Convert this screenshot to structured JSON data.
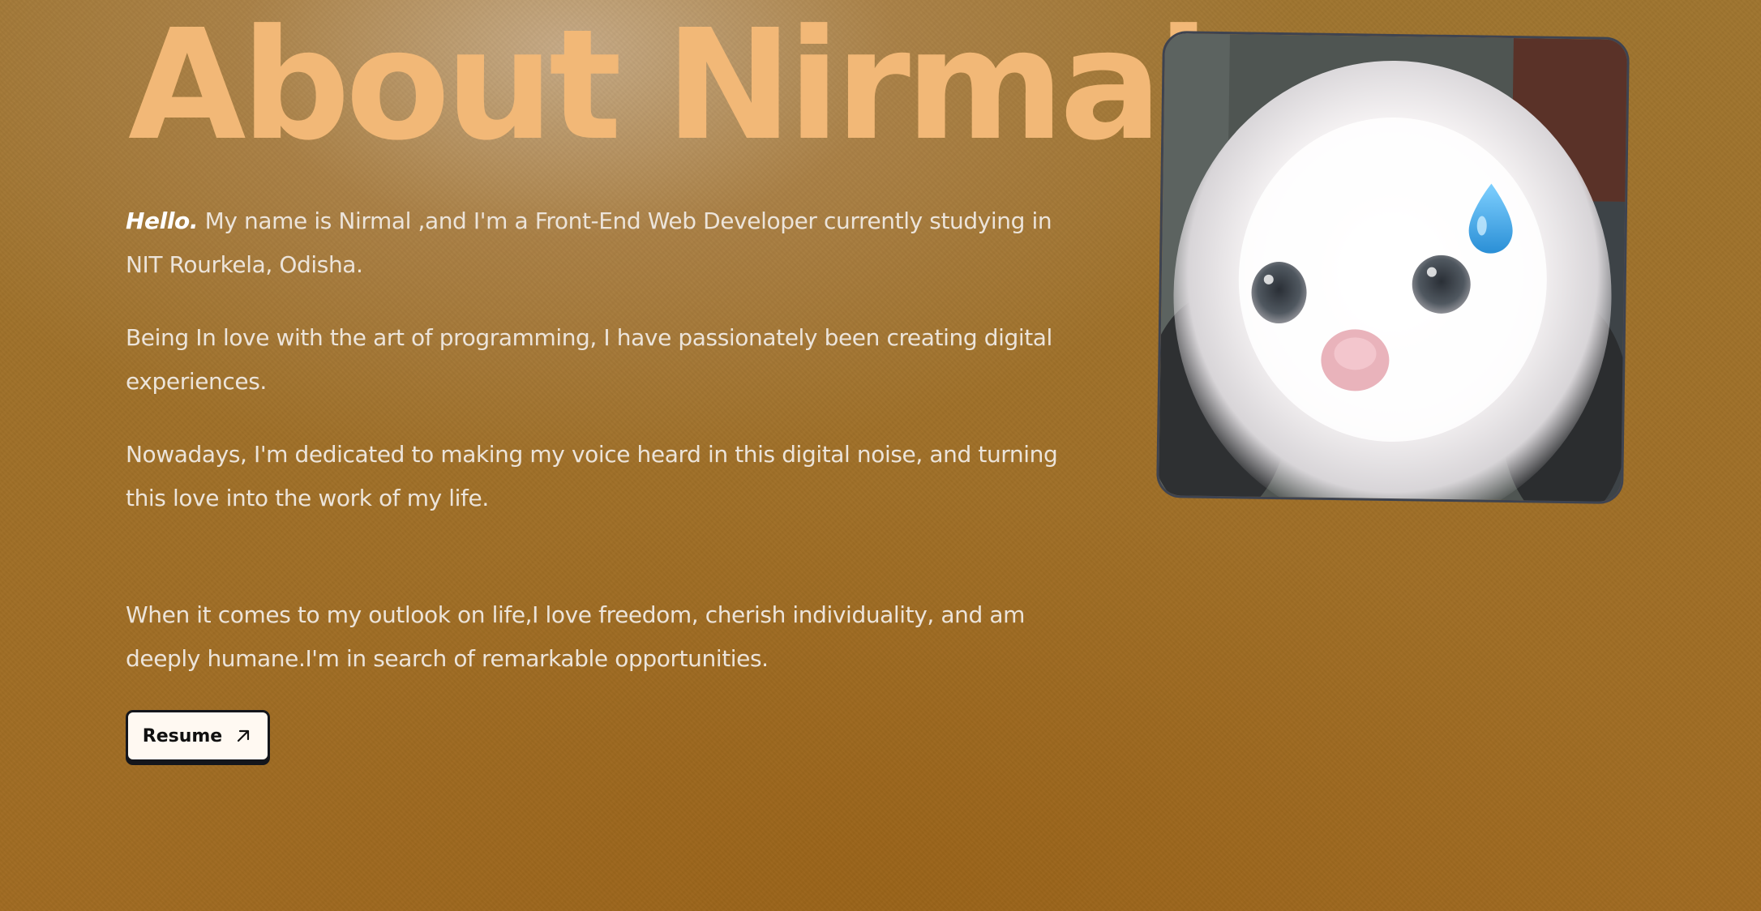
{
  "about": {
    "heading": "About Nirmal",
    "hello": "Hello.",
    "intro": " My name is Nirmal ,and I'm a Front-End Web Developer currently studying in NIT Rourkela, Odisha.",
    "passion": "Being In love with the art of programming, I have passionately been creating digital experiences.",
    "dedication": "Nowadays, I'm dedicated to making my voice heard in this digital noise, and turning this love into the work of my life.",
    "outlook": "When it comes to my outlook on life,I love freedom, cherish individuality, and am deeply humane.I'm in search of remarkable opportunities."
  },
  "resume": {
    "label": "Resume",
    "icon": "arrow-up-right-icon"
  },
  "photo": {
    "subject": "white-kitten-with-sweat-drop-emoji"
  },
  "colors": {
    "background": "#a06b22",
    "heading": "#f2b877",
    "body_text": "#ece4da",
    "button_bg": "#fff9f2",
    "button_border": "#14161c",
    "sweat_drop": "#4db2ec"
  }
}
